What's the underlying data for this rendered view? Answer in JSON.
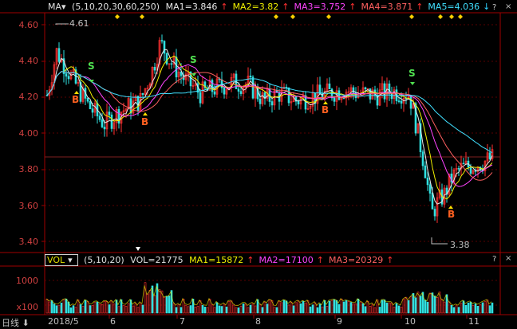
{
  "header": {
    "indicator": "MA",
    "dropdown_arrow": "▾",
    "params": "(5,10,20,30,60,250)",
    "ma_values": [
      {
        "label": "MA1=3.846",
        "arrow": "↑",
        "color": "#e8e8e8"
      },
      {
        "label": "MA2=3.82",
        "arrow": "↑",
        "color": "#f0f000"
      },
      {
        "label": "MA3=3.752",
        "arrow": "↑",
        "color": "#ff44ff"
      },
      {
        "label": "MA4=3.871",
        "arrow": "↑",
        "color": "#ff6060"
      },
      {
        "label": "MA5=4.036",
        "arrow": "↓",
        "color": "#40e0ff"
      }
    ],
    "arrow_up_color": "#ff3030",
    "arrow_down_color": "#30d0ff"
  },
  "volume_header": {
    "indicator": "VOL",
    "dropdown_arrow": "▾",
    "params": "(5,10,20)",
    "vol": "VOL=21775",
    "ma_values": [
      {
        "label": "MA1=15872",
        "arrow": "↑",
        "color": "#f0f000"
      },
      {
        "label": "MA2=17100",
        "arrow": "↑",
        "color": "#ff44ff"
      },
      {
        "label": "MA3=20329",
        "arrow": "↑",
        "color": "#ff6060"
      }
    ]
  },
  "price_axis": [
    "4.60",
    "4.40",
    "4.20",
    "4.00",
    "3.80",
    "3.60",
    "3.40"
  ],
  "volume_axis": {
    "tick": "1000",
    "multiplier": "x100"
  },
  "date_axis": {
    "period_label": "日线",
    "period_arrow": "⬇",
    "labels": [
      "2018/5",
      "6",
      "7",
      "8",
      "9",
      "10",
      "11"
    ]
  },
  "annotations": {
    "high": "4.61",
    "low": "3.38"
  },
  "signals": [
    {
      "text": "S",
      "kind": "sell"
    },
    {
      "text": "B",
      "kind": "buy"
    },
    {
      "text": "B",
      "kind": "buy"
    },
    {
      "text": "S",
      "kind": "sell"
    },
    {
      "text": "B",
      "kind": "buy"
    },
    {
      "text": "S",
      "kind": "sell"
    },
    {
      "text": "B",
      "kind": "buy"
    }
  ],
  "corner_buttons": {
    "help": "?",
    "close": "×"
  },
  "colors": {
    "up": "#ff3030",
    "down": "#30e0e0",
    "grid": "#5a0000",
    "buy": "#ff6020",
    "sell": "#50e050",
    "diamond": "#ffd000"
  }
}
